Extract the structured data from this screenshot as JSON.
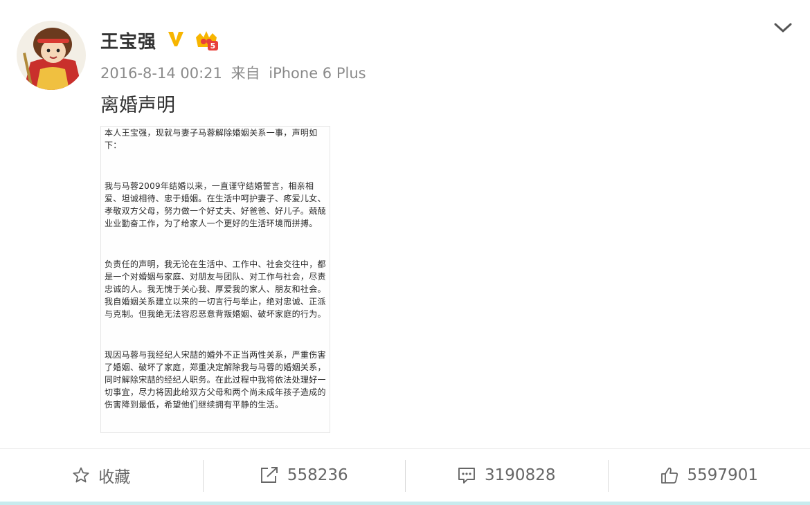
{
  "post": {
    "username": "王宝强",
    "timestamp": "2016-8-14 00:21",
    "source_prefix": "来自",
    "source_device": "iPhone 6 Plus",
    "text": "离婚声明",
    "icons": [
      "verified-v-icon",
      "vip-crown-icon",
      "chevron-down-icon"
    ]
  },
  "statement": {
    "paragraphs": [
      "本人王宝强，现就与妻子马蓉解除婚姻关系一事，声明如下：",
      "我与马蓉2009年结婚以来，一直谨守结婚誓言，相亲相爱、坦诚相待、忠于婚姻。在生活中呵护妻子、疼爱儿女、孝敬双方父母，努力做一个好丈夫、好爸爸、好儿子。兢兢业业勤奋工作，为了给家人一个更好的生活环境而拼搏。",
      "负责任的声明，我无论在生活中、工作中、社会交往中，都是一个对婚姻与家庭、对朋友与团队、对工作与社会，尽责忠诚的人。我无愧于关心我、厚爱我的家人、朋友和社会。我自婚姻关系建立以来的一切言行与举止，绝对忠诚、正派与克制。但我绝无法容忍恶意背叛婚姻、破坏家庭的行为。",
      "现因马蓉与我经纪人宋喆的婚外不正当两性关系，严重伤害了婚姻、破坏了家庭，郑重决定解除我与马蓉的婚姻关系，同时解除宋喆的经纪人职务。在此过程中我将依法处理好一切事宜，尽力将因此给双方父母和两个尚未成年孩子造成的伤害降到最低，希望他们继续拥有平静的生活。"
    ]
  },
  "actions": {
    "favorite_label": "收藏",
    "repost_count": "558236",
    "comment_count": "3190828",
    "like_count": "5597901"
  },
  "colors": {
    "verified": "#f7b500",
    "meta_text": "#8a8a8a",
    "action_text": "#666666",
    "bottom_strip": "#c8ebee"
  }
}
